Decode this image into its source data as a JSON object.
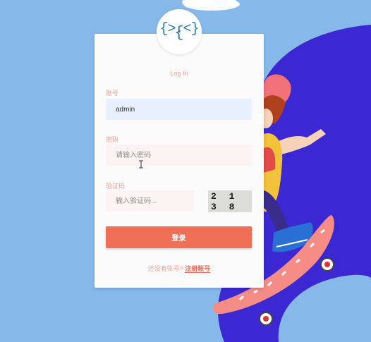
{
  "logo": {
    "text": "{>.<}",
    "icon": "code-brackets-logo-icon",
    "color": "#2c7da0"
  },
  "form": {
    "title": "Log In",
    "account": {
      "label": "账号",
      "value": "admin",
      "placeholder": ""
    },
    "password": {
      "label": "密码",
      "value": "",
      "placeholder": "请输入密码"
    },
    "captcha": {
      "label": "验证码",
      "value": "",
      "placeholder": "输入验证码...",
      "code": "2138"
    },
    "submit_label": "登录",
    "register_hint": "还没有账号?",
    "register_link": "注册账号"
  },
  "colors": {
    "background": "#86b9ea",
    "accent": "#f07057",
    "label": "#f19a90",
    "blob": "#3b28d2"
  }
}
